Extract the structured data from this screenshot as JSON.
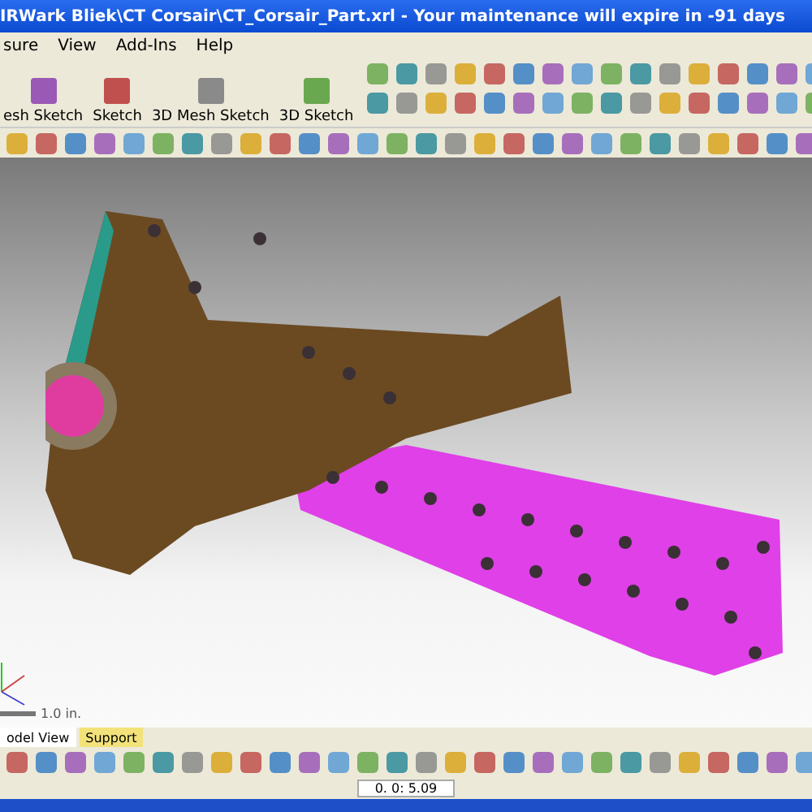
{
  "window": {
    "title": "IRWark Bliek\\CT Corsair\\CT_Corsair_Part.xrl - Your maintenance will expire in -91 days"
  },
  "menu": [
    "sure",
    "View",
    "Add-Ins",
    "Help"
  ],
  "sketch_buttons": [
    "esh Sketch",
    "Sketch",
    "3D Mesh Sketch",
    "3D Sketch"
  ],
  "viewport": {
    "scale_label": "1.0 in."
  },
  "tabs": [
    {
      "label": "odel View",
      "selected": true
    },
    {
      "label": "Support",
      "selected": false
    }
  ],
  "status_bar": {
    "field": "0. 0: 5.09"
  }
}
